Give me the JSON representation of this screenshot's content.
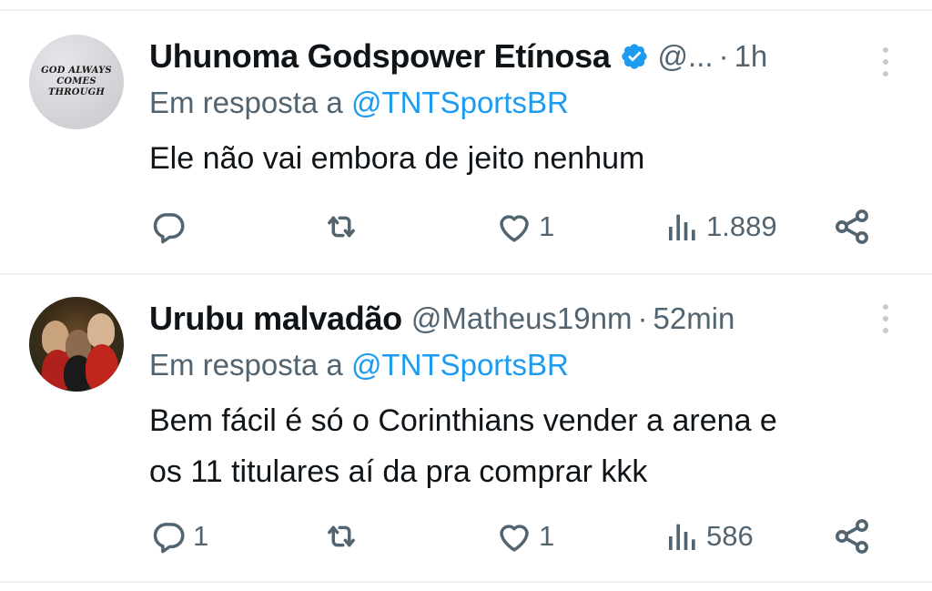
{
  "tweets": [
    {
      "author": {
        "name": "Uhunoma Godspower Etínosa",
        "handle": "@...",
        "verified": true,
        "avatar_text": [
          "GOD ALWAYS",
          "COMES THROUGH"
        ]
      },
      "separator": "·",
      "time": "1h",
      "reply_prefix": "Em resposta a",
      "reply_to": "@TNTSportsBR",
      "text_lines": [
        "Ele não vai embora de jeito nenhum"
      ],
      "replies": "",
      "likes": "1",
      "views": "1.889"
    },
    {
      "author": {
        "name": "Urubu malvadão",
        "handle": "@Matheus19nm",
        "verified": false
      },
      "separator": "·",
      "time": "52min",
      "reply_prefix": "Em resposta a",
      "reply_to": "@TNTSportsBR",
      "text_lines": [
        "Bem fácil é só o Corinthians vender a arena e",
        "os 11 titulares aí da pra comprar kkk"
      ],
      "replies": "1",
      "likes": "1",
      "views": "586"
    }
  ],
  "colors": {
    "text": "#0f1419",
    "secondary": "#536471",
    "accent": "#1d9bf0",
    "divider": "#eff3f4"
  },
  "icons": [
    "reply-icon",
    "retweet-icon",
    "like-icon",
    "views-icon",
    "share-icon",
    "verified-badge-icon",
    "more-options-icon"
  ]
}
